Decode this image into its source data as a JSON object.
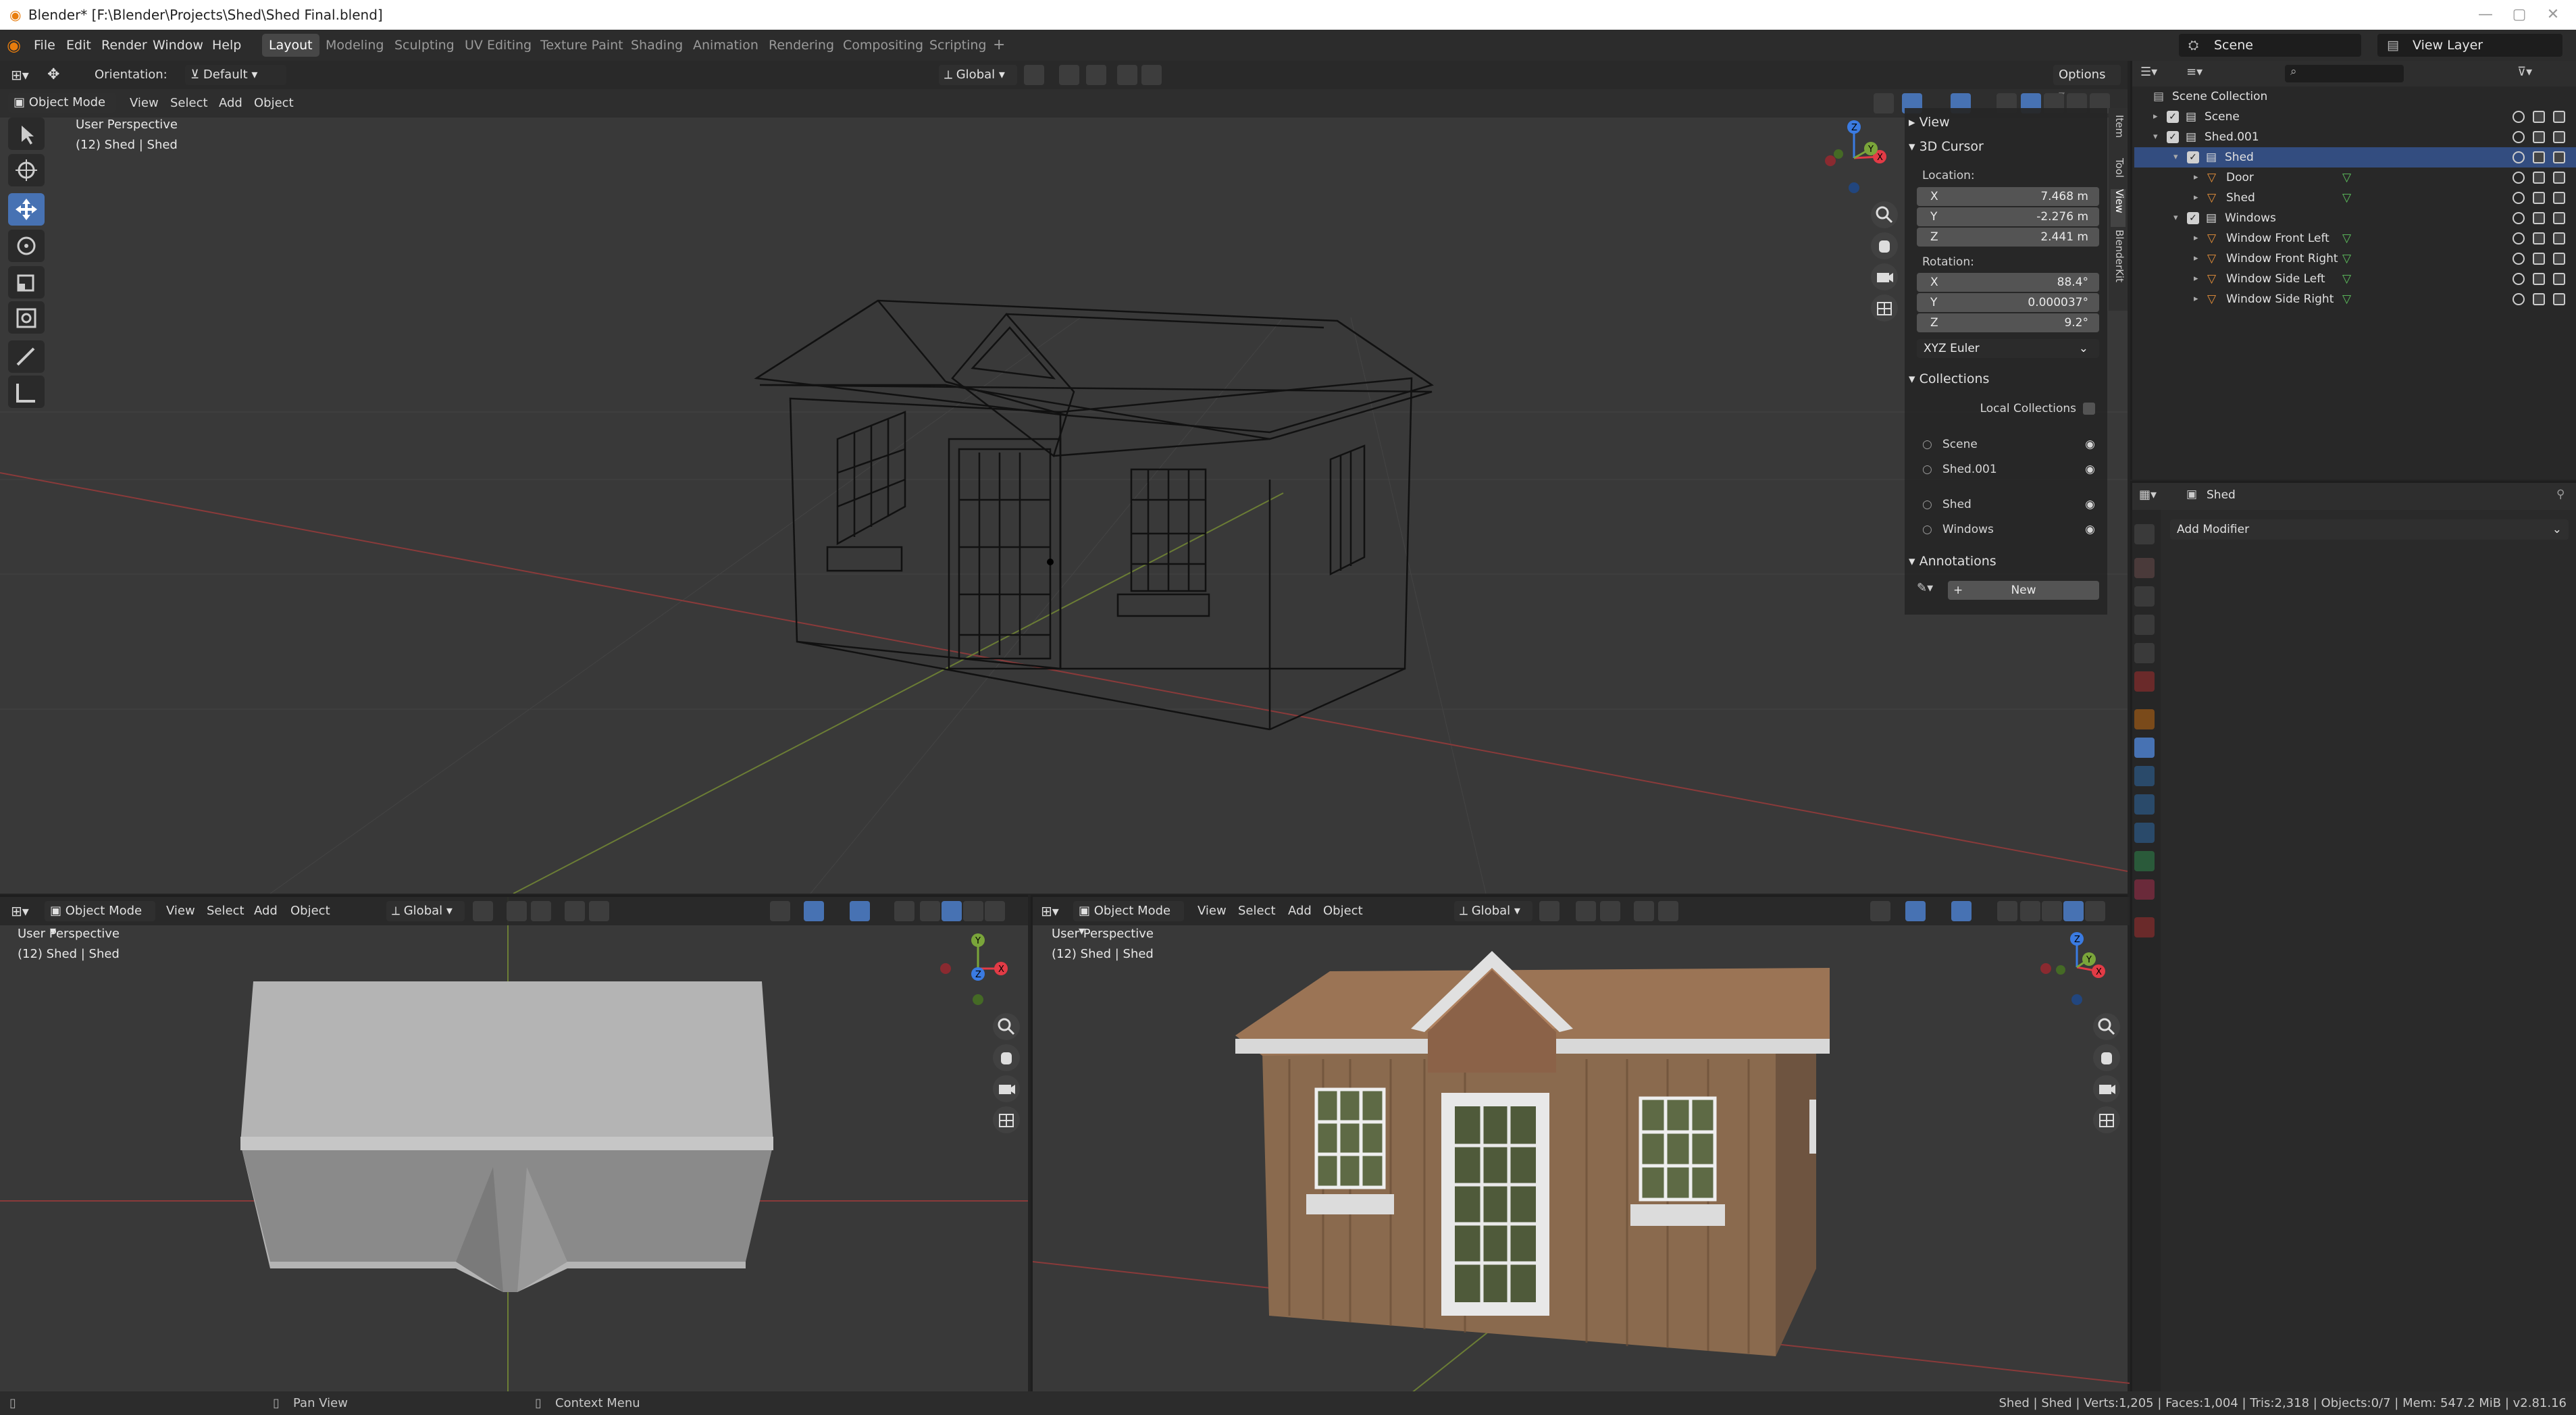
{
  "window": {
    "title": "Blender* [F:\\Blender\\Projects\\Shed\\Shed Final.blend]",
    "minimize": "—",
    "maximize": "▢",
    "close": "✕"
  },
  "menu": [
    "File",
    "Edit",
    "Render",
    "Window",
    "Help"
  ],
  "workspaces": [
    "Layout",
    "Modeling",
    "Sculpting",
    "UV Editing",
    "Texture Paint",
    "Shading",
    "Animation",
    "Rendering",
    "Compositing",
    "Scripting"
  ],
  "workspace_add": "+",
  "scene_field": "Scene",
  "view_layer_field": "View Layer",
  "tool_header": {
    "orientation_label": "Orientation:",
    "orientation_value": "Default",
    "transform_orientation": "Global",
    "options": "Options"
  },
  "main_viewport": {
    "mode": "Object Mode",
    "menus": [
      "View",
      "Select",
      "Add",
      "Object"
    ],
    "overlay_line1": "User Perspective",
    "overlay_line2": "(12) Shed | Shed",
    "shading": "wireframe"
  },
  "n_panel": {
    "tabs": [
      "Item",
      "Tool",
      "View",
      "BlenderKit"
    ],
    "view_header": "View",
    "cursor_header": "3D Cursor",
    "location_label": "Location:",
    "location": [
      {
        "axis": "X",
        "value": "7.468 m"
      },
      {
        "axis": "Y",
        "value": "-2.276 m"
      },
      {
        "axis": "Z",
        "value": "2.441 m"
      }
    ],
    "rotation_label": "Rotation:",
    "rotation": [
      {
        "axis": "X",
        "value": "88.4°"
      },
      {
        "axis": "Y",
        "value": "0.000037°"
      },
      {
        "axis": "Z",
        "value": "9.2°"
      }
    ],
    "rotation_mode": "XYZ Euler",
    "collections_header": "Collections",
    "local_collections": "Local Collections",
    "collections": [
      "Scene",
      "Shed.001",
      "Shed",
      "Windows"
    ],
    "annotations_header": "Annotations",
    "new_button": "New"
  },
  "bottom_left_viewport": {
    "mode": "Object Mode",
    "menus": [
      "View",
      "Select",
      "Add",
      "Object"
    ],
    "transform_orientation": "Global",
    "overlay_line1": "User Perspective",
    "overlay_line2": "(12) Shed | Shed",
    "shading": "solid"
  },
  "bottom_right_viewport": {
    "mode": "Object Mode",
    "menus": [
      "View",
      "Select",
      "Add",
      "Object"
    ],
    "transform_orientation": "Global",
    "overlay_line1": "User Perspective",
    "overlay_line2": "(12) Shed | Shed",
    "shading": "material preview"
  },
  "outliner": {
    "search_placeholder": "",
    "root": "Scene Collection",
    "rows": [
      {
        "label": "Scene",
        "indent": 1,
        "kind": "collection"
      },
      {
        "label": "Shed.001",
        "indent": 1,
        "kind": "collection"
      },
      {
        "label": "Shed",
        "indent": 2,
        "kind": "collection",
        "selected": true
      },
      {
        "label": "Door",
        "indent": 3,
        "kind": "mesh"
      },
      {
        "label": "Shed",
        "indent": 3,
        "kind": "mesh"
      },
      {
        "label": "Windows",
        "indent": 2,
        "kind": "collection"
      },
      {
        "label": "Window Front Left",
        "indent": 3,
        "kind": "mesh"
      },
      {
        "label": "Window Front Right",
        "indent": 3,
        "kind": "mesh"
      },
      {
        "label": "Window Side Left",
        "indent": 3,
        "kind": "mesh"
      },
      {
        "label": "Window Side Right",
        "indent": 3,
        "kind": "mesh"
      }
    ]
  },
  "properties": {
    "object_name": "Shed",
    "add_modifier": "Add Modifier"
  },
  "status_bar": {
    "pan": "Pan View",
    "context": "Context Menu",
    "stats": "Shed | Shed | Verts:1,205 | Faces:1,004 | Tris:2,318 | Objects:0/7 | Mem: 547.2 MiB | v2.81.16"
  },
  "colors": {
    "accent": "#4772b3",
    "selection_row": "#334d80",
    "x_axis": "#e23b46",
    "y_axis": "#7aa53a",
    "z_axis": "#3a7be2"
  }
}
